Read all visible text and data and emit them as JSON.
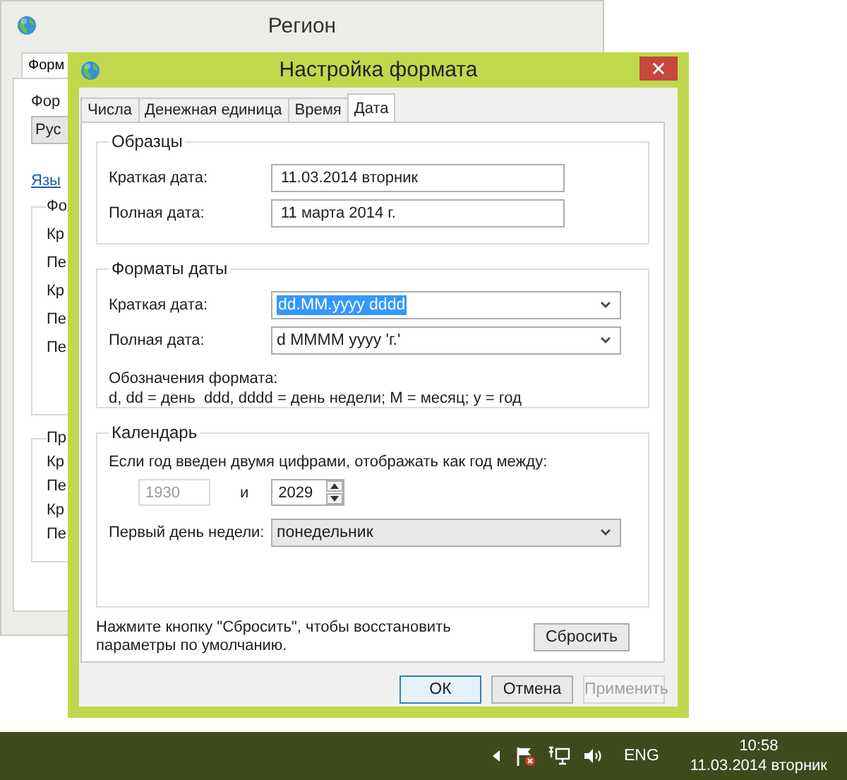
{
  "background_window": {
    "title": "Регион",
    "tab": "Форм",
    "format_label": "Фор",
    "format_value": "Рус",
    "link": "Язы",
    "groups": [
      {
        "legend": "Фо",
        "labels": [
          "Кр",
          "Пе",
          "Кр",
          "Пе",
          "Пе"
        ]
      },
      {
        "legend": "Пр",
        "labels": [
          "Кр",
          "Пе",
          "Кр",
          "Пе"
        ]
      }
    ]
  },
  "dialog": {
    "title": "Настройка формата",
    "tabs": [
      {
        "label": "Числа",
        "selected": false
      },
      {
        "label": "Денежная единица",
        "selected": false
      },
      {
        "label": "Время",
        "selected": false
      },
      {
        "label": "Дата",
        "selected": true
      }
    ],
    "samples": {
      "legend": "Образцы",
      "rows": [
        {
          "label": "Краткая дата:",
          "value": "11.03.2014 вторник"
        },
        {
          "label": "Полная дата:",
          "value": "11 марта 2014 г."
        }
      ]
    },
    "formats": {
      "legend": "Форматы даты",
      "rows": [
        {
          "label": "Краткая дата:",
          "value": "dd.MM.yyyy dddd",
          "highlighted": true
        },
        {
          "label": "Полная дата:",
          "value": "d MMMM yyyy 'г.'",
          "highlighted": false
        }
      ],
      "notation_title": "Обозначения формата:",
      "notation": "d, dd = день  ddd, dddd = день недели; M = месяц; y = год"
    },
    "calendar": {
      "legend": "Календарь",
      "two_digit_text": "Если год введен двумя цифрами, отображать как год между:",
      "from_year": {
        "value": "1930",
        "disabled": true
      },
      "and": "и",
      "to_year": "2029",
      "first_day_label": "Первый день недели:",
      "first_day_value": "понедельник"
    },
    "reset_note": "Нажмите кнопку \"Сбросить\", чтобы восстановить параметры по умолчанию.",
    "reset_button": "Сбросить",
    "buttons": [
      {
        "label": "ОК",
        "default": true,
        "disabled": false
      },
      {
        "label": "Отмена",
        "default": false,
        "disabled": false
      },
      {
        "label": "Применить",
        "default": false,
        "disabled": true
      }
    ]
  },
  "taskbar": {
    "language": "ENG",
    "time": "10:58",
    "date": "11.03.2014 вторник"
  }
}
